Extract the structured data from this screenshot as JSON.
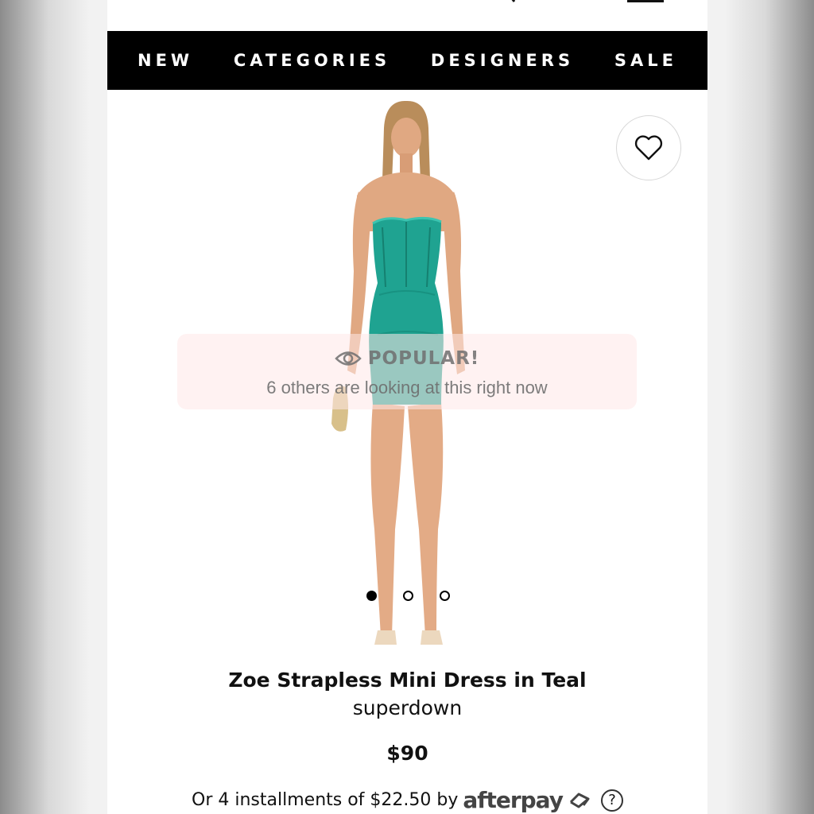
{
  "nav": {
    "items": [
      {
        "label": "NEW"
      },
      {
        "label": "CATEGORIES"
      },
      {
        "label": "DESIGNERS"
      },
      {
        "label": "SALE"
      }
    ]
  },
  "hero": {
    "popular_title": "POPULAR!",
    "popular_text": "6 others are looking at this right now",
    "carousel": {
      "count": 3,
      "active_index": 0
    }
  },
  "product": {
    "title": "Zoe Strapless Mini Dress in Teal",
    "brand": "superdown",
    "price": "$90",
    "installments_text": "Or 4 installments of $22.50 by",
    "afterpay_label": "afterpay",
    "help_label": "?"
  },
  "colors": {
    "nav_background": "#000000",
    "dress": "#1fa391",
    "skin": "#e0a882"
  },
  "icons": {
    "favorite": "heart-icon",
    "popular": "eye-icon",
    "afterpay": "afterpay-arrows-icon",
    "help": "question-icon"
  }
}
